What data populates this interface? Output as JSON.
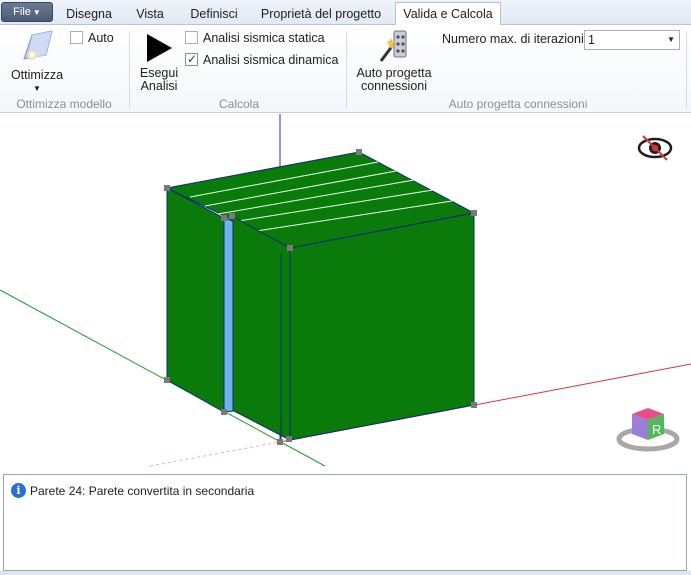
{
  "tabs": {
    "file": "File",
    "items": [
      "Disegna",
      "Vista",
      "Definisci",
      "Proprietà del progetto",
      "Valida e Calcola"
    ],
    "active": "Valida e Calcola"
  },
  "ribbon": {
    "ottimizza_group": {
      "button_label": "Ottimizza",
      "auto_label": "Auto",
      "auto_checked": false,
      "group_label": "Ottimizza modello"
    },
    "calcola_group": {
      "run_line1": "Esegui",
      "run_line2": "Analisi",
      "static_label": "Analisi sismica statica",
      "static_checked": false,
      "dynamic_label": "Analisi sismica dinamica",
      "dynamic_checked": true,
      "group_label": "Calcola"
    },
    "connessioni_group": {
      "button_line1": "Auto progetta",
      "button_line2": "connessioni",
      "iterations_label": "Numero max. di iterazioni",
      "iterations_value": "1",
      "group_label": "Auto progetta connessioni"
    }
  },
  "viewport": {
    "nav_cube_label": "R",
    "colors": {
      "wall": "#0a7a0a",
      "wall_edge": "#0b2a7a",
      "roof_lines": "#e6ffe6",
      "column": "#6cb4ea",
      "axis_x": "#d23a3a",
      "axis_y": "#2a9a2a",
      "axis_z": "#2a2ad6",
      "node": "#7a7a7a"
    }
  },
  "messages": [
    {
      "icon": "info-icon",
      "text": "Parete 24: Parete convertita in secondaria"
    }
  ]
}
